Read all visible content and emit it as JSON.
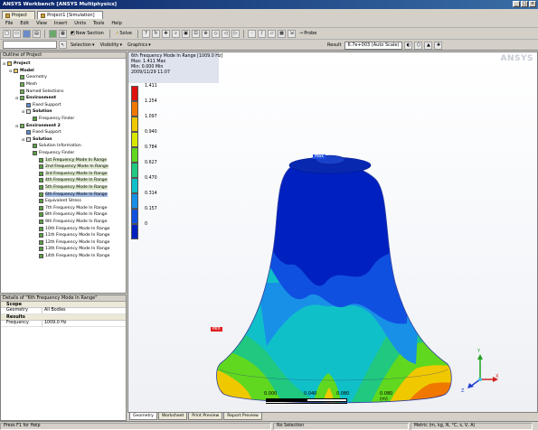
{
  "window": {
    "title": "ANSYS Workbench [ANSYS Multiphysics]",
    "controls": [
      "_",
      "□",
      "×"
    ]
  },
  "tabs": [
    {
      "label": "Project",
      "active": false
    },
    {
      "label": "Project1 [Simulation]",
      "active": true
    }
  ],
  "menu": [
    "File",
    "Edit",
    "View",
    "Insert",
    "Units",
    "Tools",
    "Help"
  ],
  "toolbar1": {
    "new_section_label": "New Section",
    "solve_label": "Solve",
    "selection_label": "Selection",
    "visibility_label": "Visibility",
    "graphics_label": "Graphics",
    "probe_label": "Probe",
    "selection_dropdown": ""
  },
  "toolbar2": {
    "result_label": "Result",
    "scale_value": "6.7e+003 (Auto Scale)"
  },
  "outline": {
    "header": "Outline of Project",
    "items": [
      {
        "label": "Project",
        "indent": 0,
        "icon": "fld",
        "bold": true
      },
      {
        "label": "Model",
        "indent": 1,
        "icon": "fld",
        "bold": true
      },
      {
        "label": "Geometry",
        "indent": 2,
        "icon": "grn"
      },
      {
        "label": "Mesh",
        "indent": 2,
        "icon": "grn"
      },
      {
        "label": "Named Selections",
        "indent": 2,
        "icon": "grn"
      },
      {
        "label": "Environment",
        "indent": 2,
        "icon": "grn",
        "bold": true
      },
      {
        "label": "Fixed Support",
        "indent": 3,
        "icon": "blu"
      },
      {
        "label": "Solution",
        "indent": 3,
        "icon": "sol",
        "bold": true
      },
      {
        "label": "Frequency Finder",
        "indent": 4,
        "icon": "chk"
      },
      {
        "label": "Environment 2",
        "indent": 2,
        "icon": "grn",
        "bold": true
      },
      {
        "label": "Fixed Support",
        "indent": 3,
        "icon": "blu"
      },
      {
        "label": "Solution",
        "indent": 3,
        "icon": "sol",
        "bold": true
      },
      {
        "label": "Solution Information",
        "indent": 4,
        "icon": "chk"
      },
      {
        "label": "Frequency Finder",
        "indent": 4,
        "icon": "chk"
      },
      {
        "label": "1st Frequency Mode In Range",
        "indent": 5,
        "icon": "chk",
        "hl": true
      },
      {
        "label": "2nd Frequency Mode In Range",
        "indent": 5,
        "icon": "chk",
        "hl": true
      },
      {
        "label": "3rd Frequency Mode In Range",
        "indent": 5,
        "icon": "chk",
        "hl": true
      },
      {
        "label": "4th Frequency Mode In Range",
        "indent": 5,
        "icon": "chk",
        "hl": true
      },
      {
        "label": "5th Frequency Mode In Range",
        "indent": 5,
        "icon": "chk",
        "hl": true
      },
      {
        "label": "6th Frequency Mode In Range",
        "indent": 5,
        "icon": "chk",
        "sel": true
      },
      {
        "label": "Equivalent Stress",
        "indent": 5,
        "icon": "chk"
      },
      {
        "label": "7th Frequency Mode In Range",
        "indent": 5,
        "icon": "chk"
      },
      {
        "label": "8th Frequency Mode In Range",
        "indent": 5,
        "icon": "chk"
      },
      {
        "label": "9th Frequency Mode In Range",
        "indent": 5,
        "icon": "chk"
      },
      {
        "label": "10th Frequency Mode In Range",
        "indent": 5,
        "icon": "chk"
      },
      {
        "label": "11th Frequency Mode In Range",
        "indent": 5,
        "icon": "chk"
      },
      {
        "label": "12th Frequency Mode In Range",
        "indent": 5,
        "icon": "chk"
      },
      {
        "label": "13th Frequency Mode In Range",
        "indent": 5,
        "icon": "chk"
      },
      {
        "label": "14th Frequency Mode In Range",
        "indent": 5,
        "icon": "chk"
      }
    ]
  },
  "details": {
    "header": "Details of \"6th Frequency Mode In Range\"",
    "sections": [
      {
        "title": "Scope",
        "rows": [
          {
            "k": "Geometry",
            "v": "All Bodies"
          }
        ]
      },
      {
        "title": "Results",
        "rows": [
          {
            "k": "Frequency",
            "v": "1009.0 Hz"
          }
        ]
      }
    ]
  },
  "viewport": {
    "info_lines": [
      "6th Frequency Mode In Range [1009.0 Hz]",
      "Max: 1.411 Max",
      "Min: 0.000 Min",
      "2009/11/29 11:07"
    ],
    "legend": [
      {
        "label": "1.411",
        "color": "#e01010"
      },
      {
        "label": "1.254",
        "color": "#f07800"
      },
      {
        "label": "1.097",
        "color": "#f0c800"
      },
      {
        "label": "0.940",
        "color": "#d8e800"
      },
      {
        "label": "0.784",
        "color": "#60d820"
      },
      {
        "label": "0.627",
        "color": "#20c880"
      },
      {
        "label": "0.470",
        "color": "#10c0c8"
      },
      {
        "label": "0.314",
        "color": "#1890e8"
      },
      {
        "label": "0.157",
        "color": "#1050e0"
      },
      {
        "label": "0",
        "color": "#0020c0"
      }
    ],
    "max_tag": "Max",
    "min_tag": "Min",
    "scale_labels": [
      "0.000",
      "0.040",
      "0.080",
      "0.080 (m)"
    ],
    "triad_labels": [
      "X",
      "Y",
      "Z"
    ],
    "watermark": "ANSYS"
  },
  "bottom_tabs": [
    {
      "label": "Geometry",
      "active": true
    },
    {
      "label": "Worksheet",
      "active": false
    },
    {
      "label": "Print Preview",
      "active": false
    },
    {
      "label": "Report Preview",
      "active": false
    }
  ],
  "status": {
    "help": "Press F1 for Help",
    "selection": "No Selection",
    "units": "Metric (m, kg, N, °C, s, V, A)"
  }
}
